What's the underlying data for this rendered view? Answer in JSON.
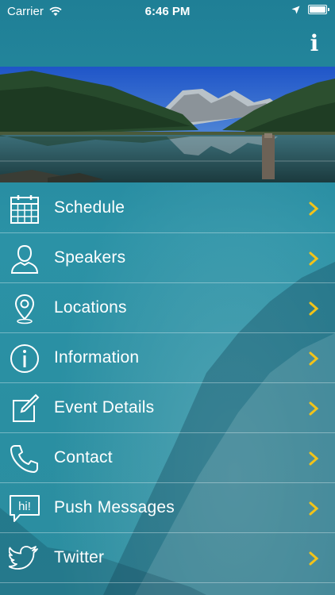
{
  "status_bar": {
    "carrier": "Carrier",
    "time": "6:46 PM"
  },
  "header": {
    "info_label": "i"
  },
  "colors": {
    "accent_chevron": "#f2c319",
    "text": "#ffffff",
    "divider": "rgba(255,255,255,0.35)"
  },
  "menu": {
    "items": [
      {
        "label": "Schedule",
        "icon": "calendar-icon"
      },
      {
        "label": "Speakers",
        "icon": "person-icon"
      },
      {
        "label": "Locations",
        "icon": "map-pin-icon"
      },
      {
        "label": "Information",
        "icon": "info-icon"
      },
      {
        "label": "Event Details",
        "icon": "edit-icon"
      },
      {
        "label": "Contact",
        "icon": "phone-icon"
      },
      {
        "label": "Push Messages",
        "icon": "chat-bubble-icon"
      },
      {
        "label": "Twitter",
        "icon": "twitter-bird-icon"
      }
    ]
  }
}
